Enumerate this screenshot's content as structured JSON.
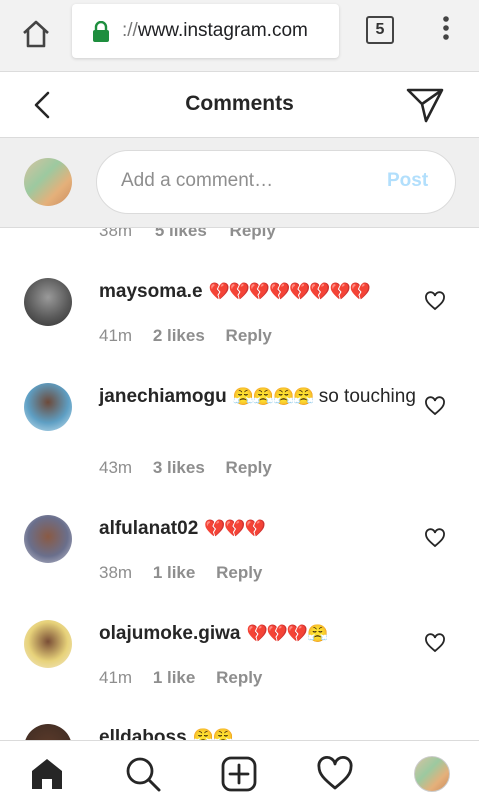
{
  "browser": {
    "url_prefix": "://",
    "url_host": "www.instagram.com",
    "tab_count": "5",
    "icons": [
      "home-icon",
      "lock-icon",
      "tabs-icon",
      "overflow-menu-icon"
    ]
  },
  "header": {
    "title": "Comments",
    "icons": [
      "back-arrow-icon",
      "direct-send-icon"
    ]
  },
  "composer": {
    "placeholder": "Add a comment…",
    "post_label": "Post",
    "post_color": "#b2dffc"
  },
  "partial_comment": {
    "time": "38m",
    "likes": "5 likes",
    "reply": "Reply"
  },
  "comments": [
    {
      "username": "maysoma.e",
      "emoji": "💔💔💔💔💔💔💔💔",
      "text": "",
      "time": "41m",
      "likes": "2 likes",
      "reply": "Reply"
    },
    {
      "username": "janechiamogu",
      "emoji": "😤😤😤😤",
      "text": "so touching",
      "time": "43m",
      "likes": "3 likes",
      "reply": "Reply"
    },
    {
      "username": "alfulanat02",
      "emoji": "💔💔💔",
      "text": "",
      "time": "38m",
      "likes": "1 like",
      "reply": "Reply"
    },
    {
      "username": "olajumoke.giwa",
      "emoji": "💔💔💔😤",
      "text": "",
      "time": "41m",
      "likes": "1 like",
      "reply": "Reply"
    },
    {
      "username": "elldaboss",
      "emoji": "😤😤",
      "text": "",
      "time": "",
      "likes": "",
      "reply": ""
    }
  ],
  "bottom_nav": {
    "items": [
      "home-icon",
      "search-icon",
      "new-post-icon",
      "activity-heart-icon",
      "profile-avatar"
    ]
  },
  "colors": {
    "text": "#262626",
    "secondary": "#8e8e8e",
    "border": "#dbdbdb",
    "chrome_bg": "#f2f2f2",
    "lock_green": "#1e8e3e"
  }
}
